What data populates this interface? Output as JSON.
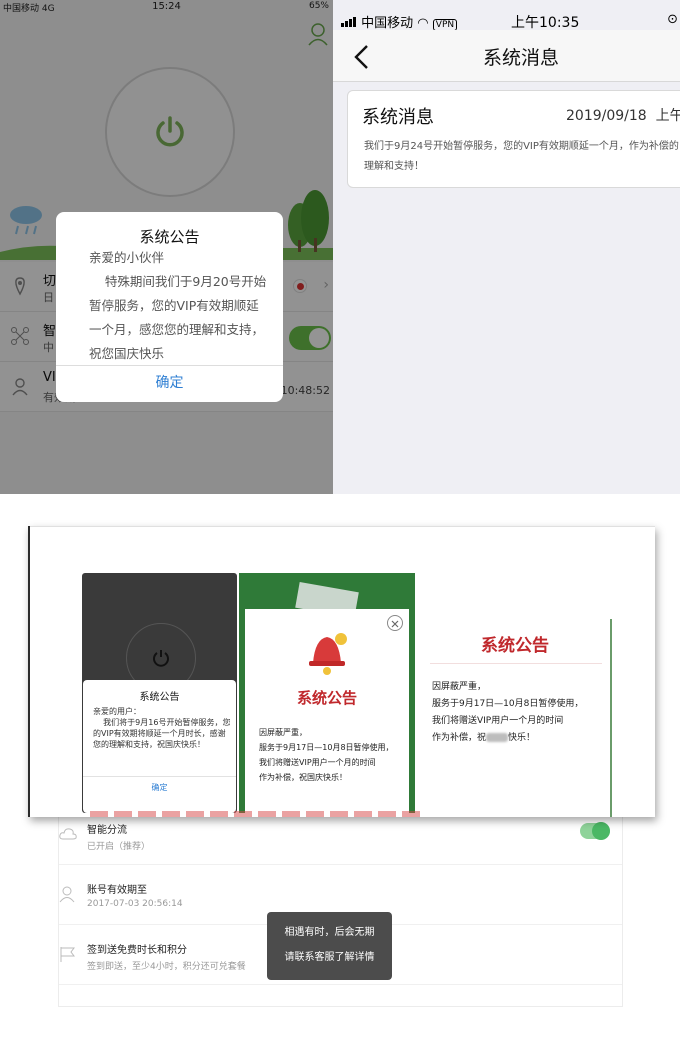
{
  "screen_a": {
    "status": {
      "carrier": "中国移动",
      "network": "4G",
      "time": "15:24",
      "battery": "65%"
    },
    "rows": [
      {
        "title": "切",
        "subtitle": "日"
      },
      {
        "title": "智",
        "subtitle": "中"
      },
      {
        "title": "VI",
        "subtitle": "有效期至",
        "time": "10:48:52"
      }
    ],
    "dialog": {
      "title": "系统公告",
      "greeting": "亲爱的小伙伴",
      "body": "    特殊期间我们于9月20号开始暂停服务，您的VIP有效期顺延一个月，感您您的理解和支持，祝您国庆快乐",
      "confirm": "确定"
    }
  },
  "screen_b": {
    "status": {
      "carrier": "中国移动",
      "vpn": "VPN",
      "time": "上午10:35"
    },
    "nav_title": "系统消息",
    "card": {
      "title": "系统消息",
      "date": "2019/09/18",
      "ampm": "上午",
      "body": "我们于9月24号开始暂停服务，您的VIP有效期顺延一个月，作为补偿的理解和支持！"
    }
  },
  "screen_c": {
    "panel1": {
      "title": "系统公告",
      "greeting": "亲爱的用户：",
      "body": "    我们将于9月16号开始暂停服务，您的VIP有效期将顺延一个月时长，感谢您的理解和支持，祝国庆快乐！",
      "confirm": "确定"
    },
    "panel2": {
      "title": "系统公告",
      "line1": "因屏蔽严重，",
      "line2": "服务于9月17日—10月8日暂停使用，",
      "line3": "我们将赠送VIP用户一个月的时间",
      "line4": "作为补偿，祝国庆快乐！"
    },
    "panel3": {
      "title": "系统公告",
      "line1": "因屏蔽严重，",
      "line2": "服务于9月17日—10月8日暂停使用，",
      "line3": "我们将赠送VIP用户一个月的时间",
      "line4a": "作为补偿，祝",
      "line4b": "快乐！"
    },
    "rows": [
      {
        "title": "智能分流",
        "subtitle": "已开启（推荐）"
      },
      {
        "title": "账号有效期至",
        "subtitle": "2017-07-03 20:56:14"
      },
      {
        "title": "签到送免费时长和积分",
        "subtitle": "签到即送，至少4小时，积分还可兑套餐"
      }
    ],
    "toast": {
      "line1": "相遇有时，后会无期",
      "line2": "请联系客服了解详情"
    }
  },
  "colors": {
    "accent_blue": "#2f7fd3",
    "green": "#6cc24a",
    "red_title": "#c0282c"
  }
}
